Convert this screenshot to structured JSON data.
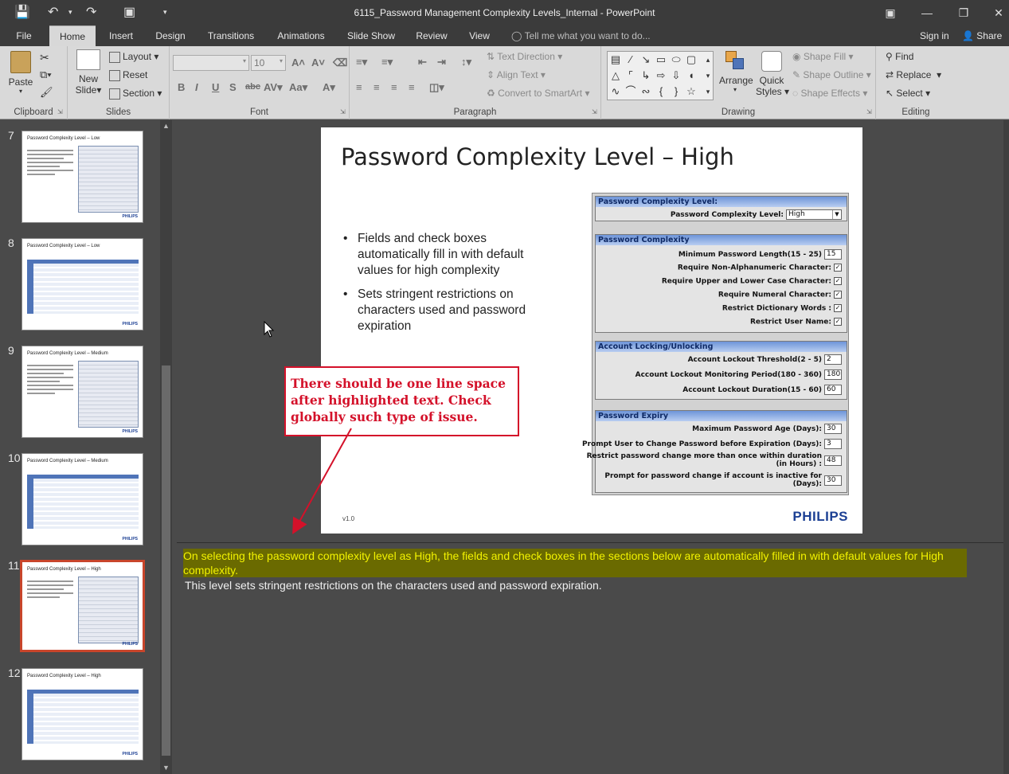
{
  "window": {
    "title": "6115_Password Management Complexity Levels_Internal - PowerPoint"
  },
  "tabs": [
    "File",
    "Home",
    "Insert",
    "Design",
    "Transitions",
    "Animations",
    "Slide Show",
    "Review",
    "View"
  ],
  "tell_me": "Tell me what you want to do...",
  "sign_in": "Sign in",
  "share": "Share",
  "ribbon": {
    "clipboard": {
      "label": "Clipboard",
      "paste": "Paste"
    },
    "slides": {
      "label": "Slides",
      "new_slide": "New",
      "new_slide2": "Slide",
      "layout": "Layout",
      "reset": "Reset",
      "section": "Section"
    },
    "font": {
      "label": "Font",
      "size": "10"
    },
    "paragraph": {
      "label": "Paragraph",
      "text_direction": "Text Direction",
      "align_text": "Align Text",
      "smartart": "Convert to SmartArt"
    },
    "drawing": {
      "label": "Drawing",
      "arrange": "Arrange",
      "quick_styles": "Quick",
      "quick_styles2": "Styles",
      "shape_fill": "Shape Fill",
      "shape_outline": "Shape Outline",
      "shape_effects": "Shape Effects"
    },
    "editing": {
      "label": "Editing",
      "find": "Find",
      "replace": "Replace",
      "select": "Select"
    }
  },
  "thumbnails": [
    {
      "num": "7",
      "title": "Password Complexity Level – Low",
      "kind": "dialog"
    },
    {
      "num": "8",
      "title": "Password Complexity Level – Low",
      "kind": "table"
    },
    {
      "num": "9",
      "title": "Password Complexity Level – Medium",
      "kind": "dialog"
    },
    {
      "num": "10",
      "title": "Password Complexity Level – Medium",
      "kind": "table"
    },
    {
      "num": "11",
      "title": "Password Complexity Level – High",
      "kind": "dialog",
      "selected": true
    },
    {
      "num": "12",
      "title": "Password Complexity Level – High",
      "kind": "table"
    }
  ],
  "slide": {
    "title": "Password Complexity Level – High",
    "bullets": [
      "Fields and check boxes automatically fill in with default values for high complexity",
      "Sets stringent restrictions on characters used and password expiration"
    ],
    "version": "v1.0",
    "logo": "PHILIPS",
    "dialog": {
      "level_section": "Password Complexity Level:",
      "level_label": "Password Complexity Level:",
      "level_value": "High",
      "complexity_section": "Password Complexity",
      "min_length_label": "Minimum Password Length(15 - 25)",
      "min_length_value": "15",
      "nonalpha": "Require Non-Alphanumeric Character:",
      "upperlower": "Require Upper and Lower Case Character:",
      "numeral": "Require Numeral Character:",
      "dictionary": "Restrict Dictionary Words :",
      "username": "Restrict User Name:",
      "locking_section": "Account Locking/Unlocking",
      "lockout_threshold_label": "Account Lockout Threshold(2 - 5)",
      "lockout_threshold_value": "2",
      "monitoring_label": "Account Lockout Monitoring Period(180 - 360)",
      "monitoring_value": "180",
      "duration_label": "Account Lockout Duration(15 - 60)",
      "duration_value": "60",
      "expiry_section": "Password Expiry",
      "max_age_label": "Maximum Password Age (Days):",
      "max_age_value": "30",
      "prompt_label": "Prompt User to Change Password before Expiration (Days):",
      "prompt_value": "3",
      "restrict_change_label1": "Restrict password change more than once within duration",
      "restrict_change_label2": "(in Hours) :",
      "restrict_change_value": "48",
      "inactive_label1": "Prompt for password change if account is inactive for",
      "inactive_label2": "(Days):",
      "inactive_value": "30"
    }
  },
  "callout": "There should be one line space after highlighted text. Check globally such type of issue.",
  "notes": {
    "highlighted": "On selecting the password complexity level as High, the fields and check boxes in the sections below are automatically filled in with default values for High complexity.",
    "plain": "This level sets stringent restrictions on the characters used and password expiration."
  },
  "colors": {
    "accent_tab": "#d8d8d8",
    "callout_red": "#d4112a",
    "highlight_bg": "#6a6a00",
    "highlight_text": "#f2f200",
    "selected_thumb": "#c8452b"
  }
}
